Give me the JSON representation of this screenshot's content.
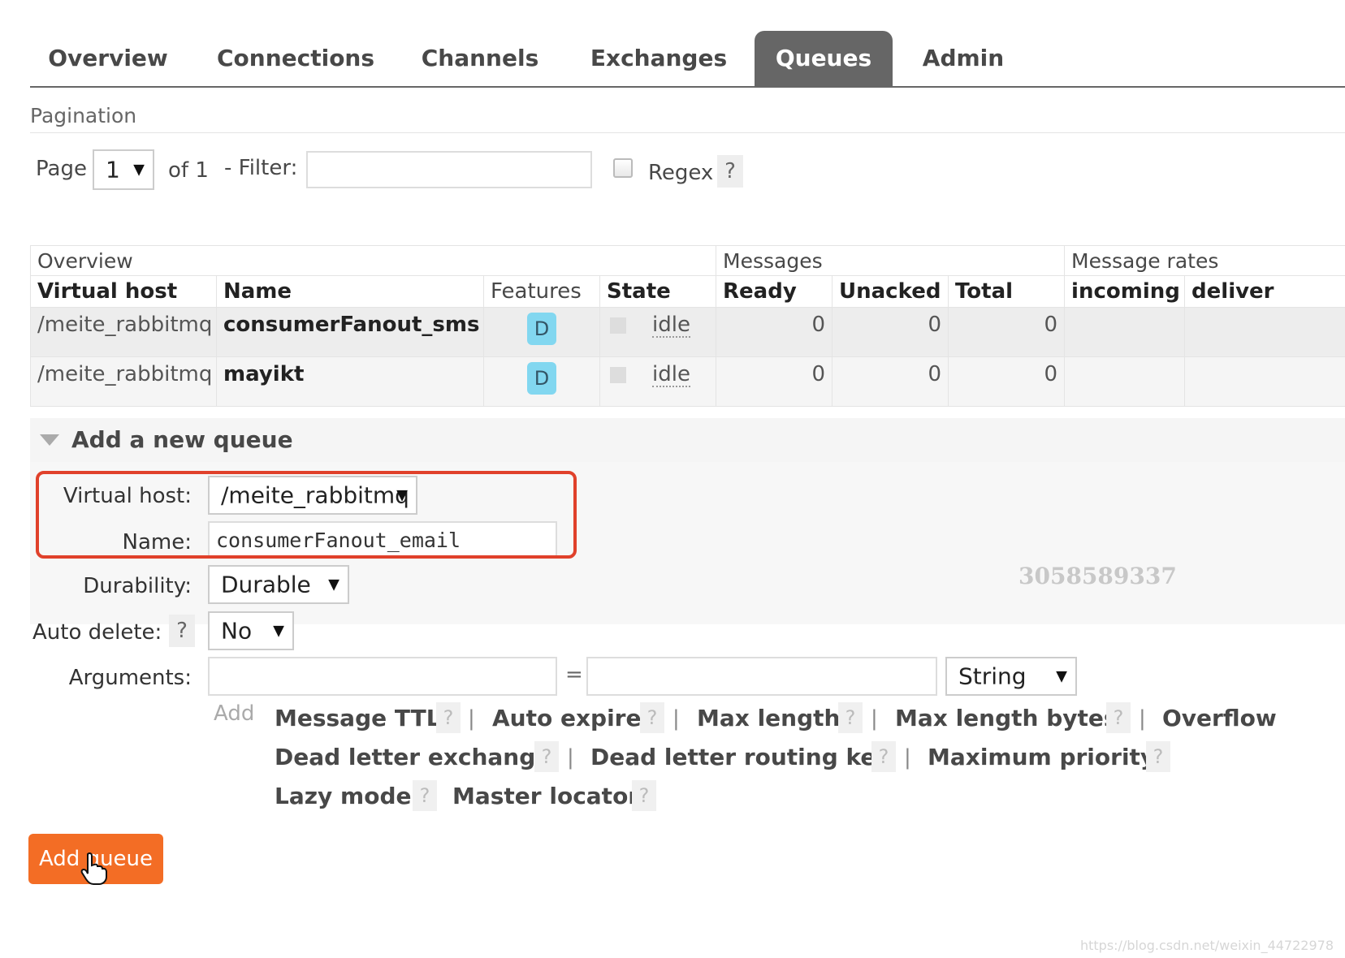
{
  "tabs": [
    {
      "label": "Overview"
    },
    {
      "label": "Connections"
    },
    {
      "label": "Channels"
    },
    {
      "label": "Exchanges"
    },
    {
      "label": "Queues",
      "active": true
    },
    {
      "label": "Admin"
    }
  ],
  "pagination": {
    "heading": "Pagination",
    "page_label": "Page",
    "page_value": "1",
    "of_label": "of 1",
    "filter_label": "- Filter:",
    "filter_value": "",
    "regex_label": "Regex",
    "help": "?"
  },
  "table": {
    "groups": [
      "Overview",
      "Messages",
      "Message rates"
    ],
    "columns": [
      "Virtual host",
      "Name",
      "Features",
      "State",
      "Ready",
      "Unacked",
      "Total",
      "incoming",
      "deliver"
    ],
    "rows": [
      {
        "vhost": "/meite_rabbitmq",
        "name": "consumerFanout_sms",
        "feature": "D",
        "state": "idle",
        "ready": "0",
        "unacked": "0",
        "total": "0"
      },
      {
        "vhost": "/meite_rabbitmq",
        "name": "mayikt",
        "feature": "D",
        "state": "idle",
        "ready": "0",
        "unacked": "0",
        "total": "0"
      }
    ]
  },
  "add_queue": {
    "title": "Add a new queue",
    "virtual_host_label": "Virtual host:",
    "virtual_host_value": "/meite_rabbitmq",
    "name_label": "Name:",
    "name_value": "consumerFanout_email",
    "durability_label": "Durability:",
    "durability_value": "Durable",
    "auto_delete_label": "Auto delete:",
    "auto_delete_value": "No",
    "arguments_label": "Arguments:",
    "equals": "=",
    "arg_type_value": "String",
    "add_label": "Add",
    "options": [
      "Message TTL",
      "Auto expire",
      "Max length",
      "Max length bytes",
      "Overflow",
      "Dead letter exchange",
      "Dead letter routing key",
      "Maximum priority",
      "Lazy mode",
      "Master locator"
    ],
    "separator": "|",
    "help": "?",
    "submit_label": "Add queue"
  },
  "watermark": {
    "number": "3058589337",
    "url": "https://blog.csdn.net/weixin_44722978"
  },
  "colors": {
    "accent": "#f36d25",
    "tab_active": "#666666",
    "highlight": "#e0412b",
    "feature_badge": "#82d7f0"
  }
}
